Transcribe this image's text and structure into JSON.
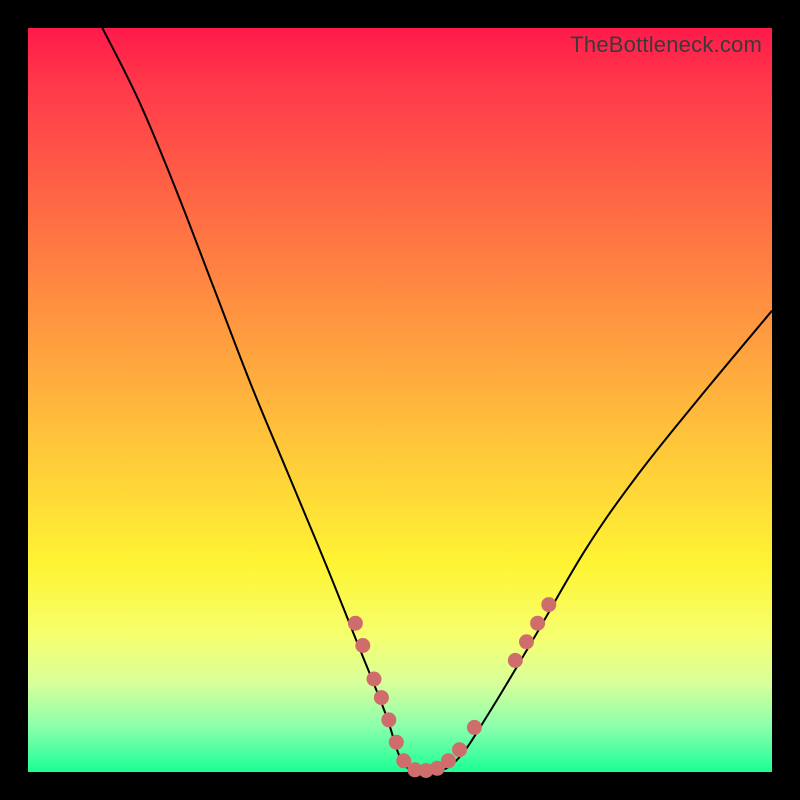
{
  "watermark": "TheBottleneck.com",
  "colors": {
    "frame": "#000000",
    "curve": "#000000",
    "dot": "#cf6d6d",
    "gradient_top": "#ff1a4b",
    "gradient_bottom": "#1aff94"
  },
  "chart_data": {
    "type": "line",
    "title": "",
    "xlabel": "",
    "ylabel": "",
    "xlim": [
      0,
      100
    ],
    "ylim": [
      0,
      100
    ],
    "grid": false,
    "legend": false,
    "series": [
      {
        "name": "bottleneck-curve",
        "x": [
          10,
          15,
          20,
          25,
          30,
          35,
          40,
          44,
          48,
          50,
          52,
          55,
          58,
          62,
          68,
          75,
          82,
          90,
          100
        ],
        "y": [
          100,
          90,
          78,
          65,
          52,
          40,
          28,
          18,
          8,
          2,
          0,
          0,
          2,
          8,
          18,
          30,
          40,
          50,
          62
        ]
      }
    ],
    "markers": [
      {
        "x": 44.0,
        "y": 20.0
      },
      {
        "x": 45.0,
        "y": 17.0
      },
      {
        "x": 46.5,
        "y": 12.5
      },
      {
        "x": 47.5,
        "y": 10.0
      },
      {
        "x": 48.5,
        "y": 7.0
      },
      {
        "x": 49.5,
        "y": 4.0
      },
      {
        "x": 50.5,
        "y": 1.5
      },
      {
        "x": 52.0,
        "y": 0.3
      },
      {
        "x": 53.5,
        "y": 0.2
      },
      {
        "x": 55.0,
        "y": 0.5
      },
      {
        "x": 56.5,
        "y": 1.5
      },
      {
        "x": 58.0,
        "y": 3.0
      },
      {
        "x": 60.0,
        "y": 6.0
      },
      {
        "x": 65.5,
        "y": 15.0
      },
      {
        "x": 67.0,
        "y": 17.5
      },
      {
        "x": 68.5,
        "y": 20.0
      },
      {
        "x": 70.0,
        "y": 22.5
      }
    ]
  }
}
